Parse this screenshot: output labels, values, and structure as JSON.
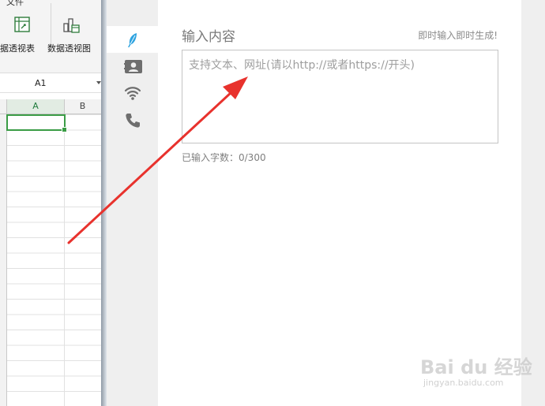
{
  "spreadsheet": {
    "menu_file": "文件",
    "ribbon": {
      "pivot_table_label": "据透视表",
      "pivot_chart_label": "数据透视图"
    },
    "name_box": "A1",
    "columns": [
      "A",
      "B"
    ]
  },
  "dialog": {
    "nav_items": [
      {
        "name": "text",
        "icon": "feather-icon",
        "active": true
      },
      {
        "name": "contact",
        "icon": "contact-card-icon",
        "active": false
      },
      {
        "name": "wifi",
        "icon": "wifi-icon",
        "active": false
      },
      {
        "name": "phone",
        "icon": "phone-icon",
        "active": false
      }
    ],
    "title": "输入内容",
    "hint": "即时输入即时生成!",
    "textarea": {
      "placeholder": "支持文本、网址(请以http://或者https://开头)",
      "value": ""
    },
    "counter": "已输入字数：0/300"
  },
  "watermark": {
    "main": "Bai du 经验",
    "sub": "jingyan.baidu.com"
  },
  "colors": {
    "accent": "#2ea3e0",
    "arrow": "#e8322d",
    "selected_cell": "#3a9c45"
  }
}
